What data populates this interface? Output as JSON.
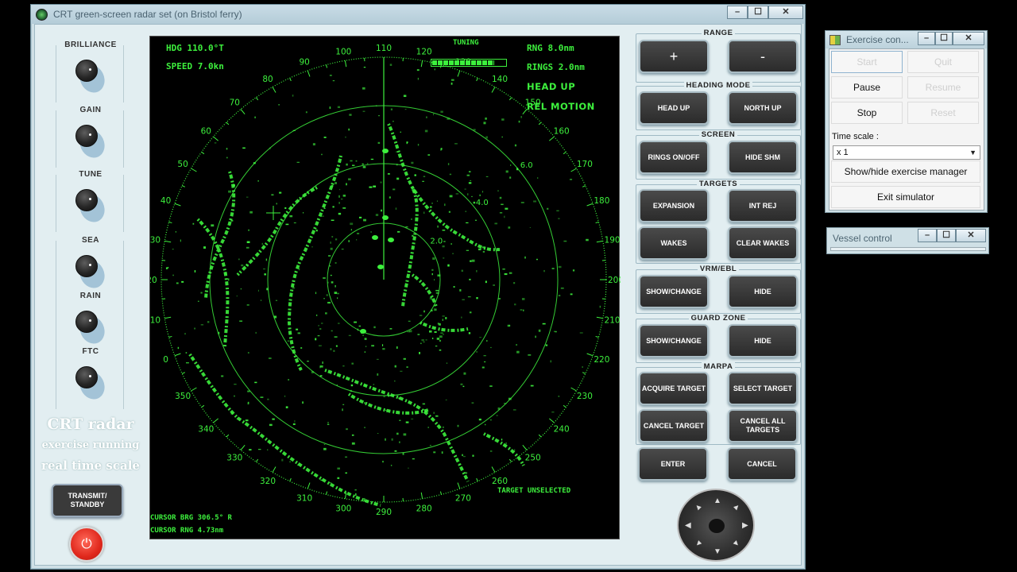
{
  "main_window": {
    "title": "CRT green-screen radar set (on Bristol ferry)",
    "minimize": "–",
    "maximize": "☐",
    "close": "✕"
  },
  "left_panel": {
    "knobs": [
      "BRILLIANCE",
      "GAIN",
      "TUNE",
      "SEA",
      "RAIN",
      "FTC"
    ],
    "brand": "CRT radar",
    "status": "exercise running",
    "scale": "real time scale",
    "transmit_label": "TRANSMIT/ STANDBY",
    "power_icon": "⏻"
  },
  "radar": {
    "heading": "HDG 110.0°T",
    "speed": "SPEED   7.0kn",
    "tuning_label": "TUNING",
    "tuning_level": 0.85,
    "range": "RNG 8.0nm",
    "rings": "RINGS 2.0nm",
    "mode": "HEAD UP",
    "motion": "REL MOTION",
    "target_status": "TARGET UNSELECTED",
    "cursor_brg": "CURSOR BRG 306.5° R",
    "cursor_rng": "CURSOR RNG  4.73nm",
    "ring_labels": [
      "2.0",
      "4.0",
      "6.0"
    ],
    "bearings": [
      "0",
      "10",
      "20",
      "30",
      "40",
      "50",
      "60",
      "70",
      "80",
      "90",
      "100",
      "110",
      "120",
      "130",
      "140",
      "150",
      "160",
      "170",
      "180",
      "190",
      "200",
      "210",
      "220",
      "230",
      "240",
      "250",
      "260",
      "270",
      "280",
      "290",
      "300",
      "310",
      "320",
      "330",
      "340",
      "350"
    ],
    "colors": {
      "phosphor": "#3df03d",
      "screen": "#000000"
    }
  },
  "controls": {
    "range": {
      "title": "RANGE",
      "plus": "+",
      "minus": "-"
    },
    "heading_mode": {
      "title": "HEADING MODE",
      "head_up": "HEAD UP",
      "north_up": "NORTH UP"
    },
    "screen": {
      "title": "SCREEN",
      "rings": "RINGS ON/OFF",
      "hide_shm": "HIDE SHM"
    },
    "targets": {
      "title": "TARGETS",
      "expansion": "EXPANSION",
      "int_rej": "INT REJ",
      "wakes": "WAKES",
      "clear_wakes": "CLEAR WAKES"
    },
    "vrm_ebl": {
      "title": "VRM/EBL",
      "show": "SHOW/CHANGE",
      "hide": "HIDE"
    },
    "guard_zone": {
      "title": "GUARD ZONE",
      "show": "SHOW/CHANGE",
      "hide": "HIDE"
    },
    "marpa": {
      "title": "MARPA",
      "acquire": "ACQUIRE TARGET",
      "select": "SELECT TARGET",
      "cancel": "CANCEL TARGET",
      "cancel_all": "CANCEL ALL TARGETS"
    },
    "enter": "ENTER",
    "cancel": "CANCEL"
  },
  "exercise_window": {
    "title": "Exercise con...",
    "start": "Start",
    "quit": "Quit",
    "pause": "Pause",
    "resume": "Resume",
    "stop": "Stop",
    "reset": "Reset",
    "time_scale_label": "Time scale :",
    "time_scale_value": "x 1",
    "show_hide": "Show/hide exercise manager",
    "exit": "Exit simulator"
  },
  "vessel_window": {
    "title": "Vessel control"
  }
}
